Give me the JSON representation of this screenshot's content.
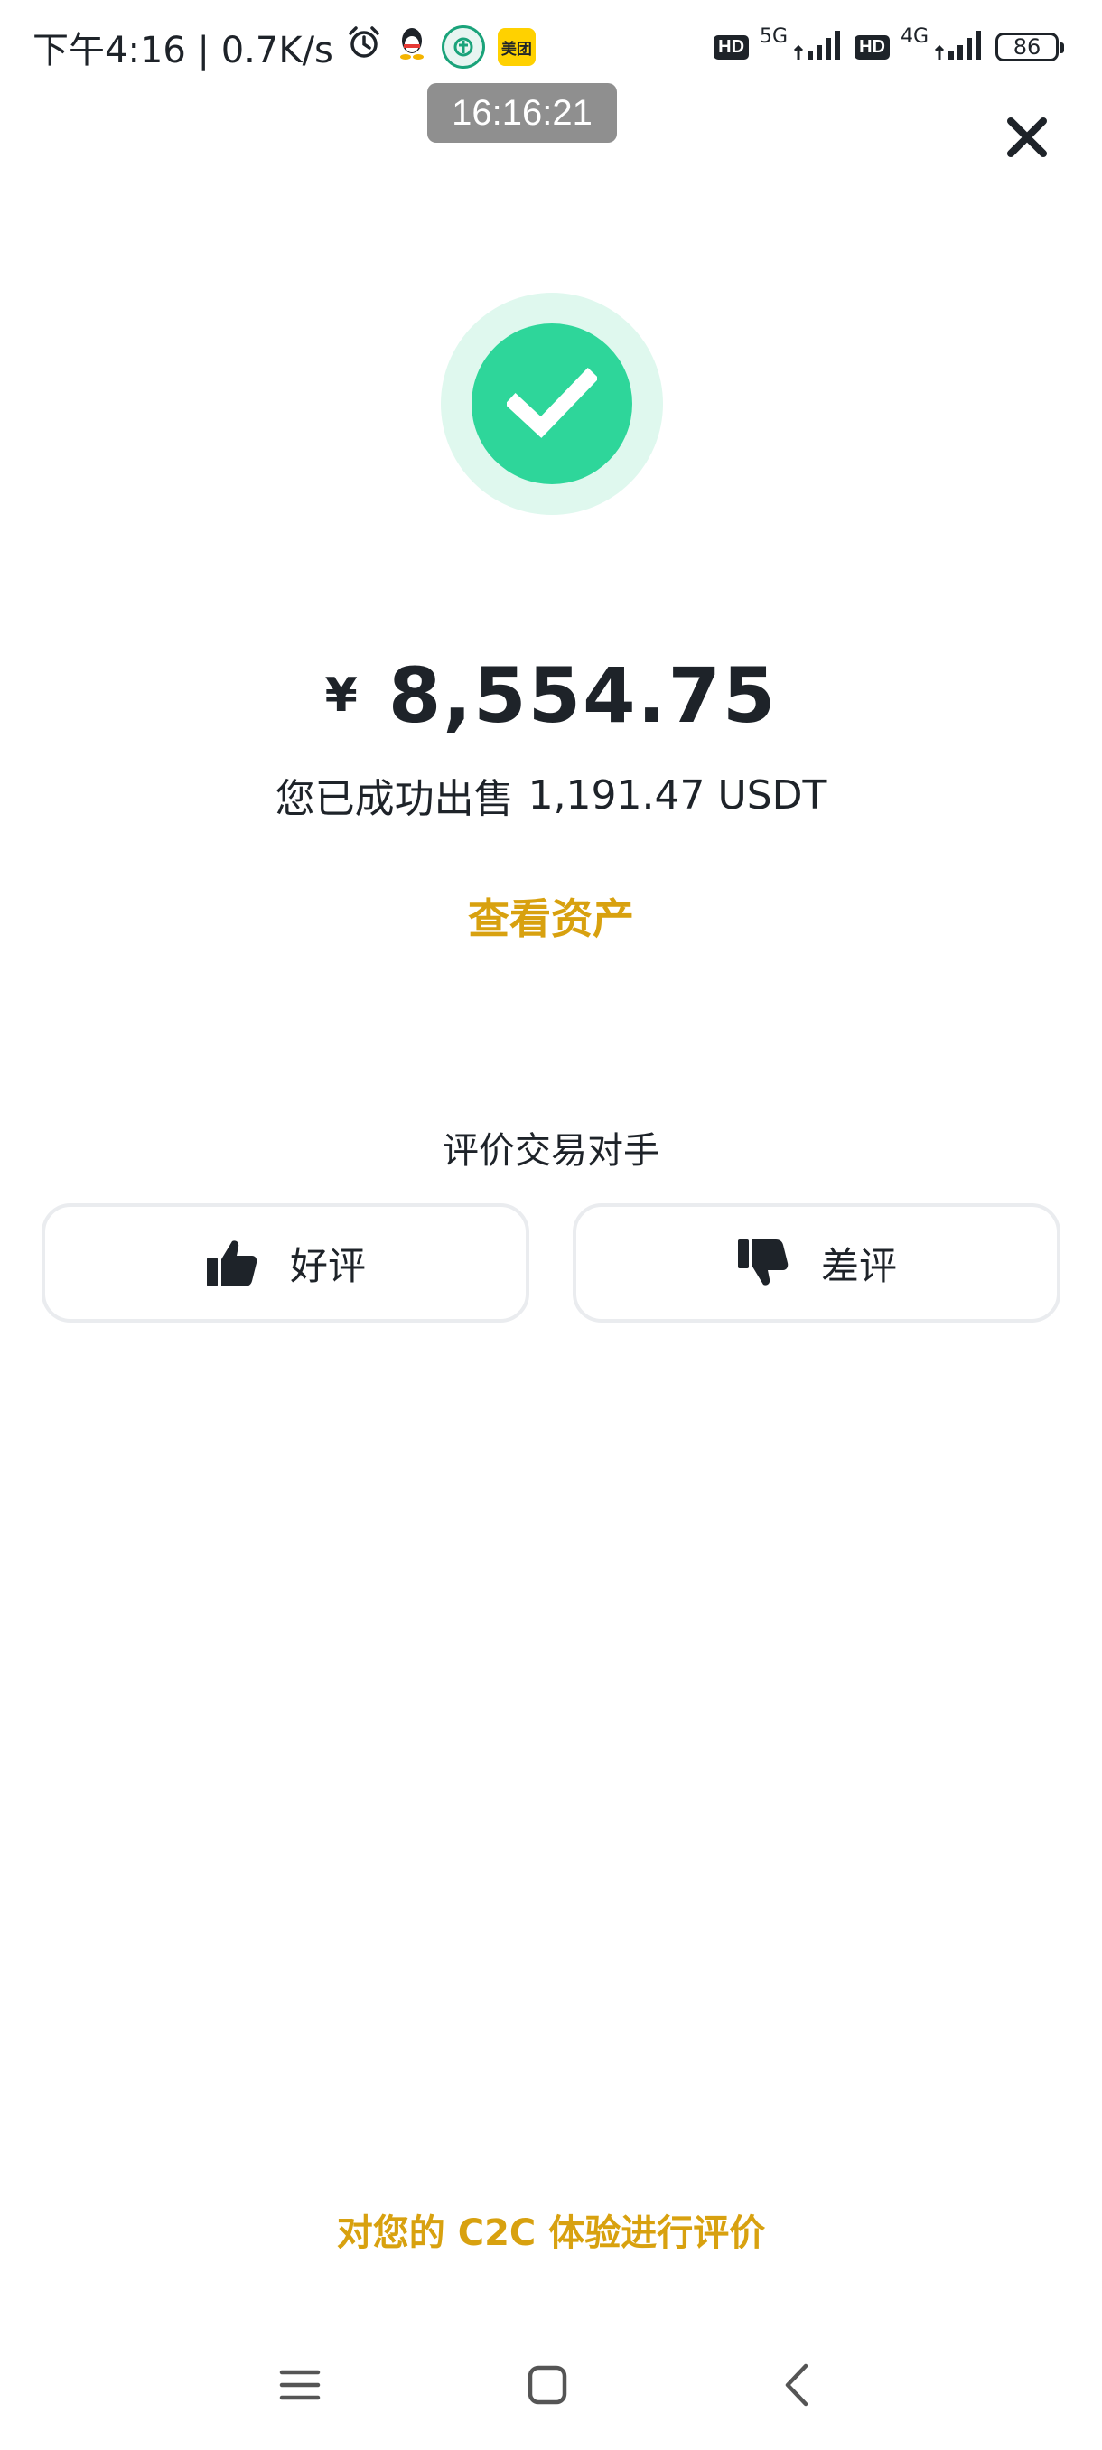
{
  "status_bar": {
    "time_and_speed": "下午4:16 | 0.7K/s",
    "meituan_label": "美团",
    "hd_label": "HD",
    "net_5g": "5G",
    "net_4g": "4G",
    "battery": "86"
  },
  "time_overlay": "16:16:21",
  "success": {
    "currency_symbol": "¥",
    "amount": "8,554.75",
    "sold_prefix": "您已成功出售",
    "sold_amount": "1,191.47 USDT",
    "view_assets": "查看资产"
  },
  "rating": {
    "title": "评价交易对手",
    "good_label": "好评",
    "bad_label": "差评"
  },
  "feedback_link": "对您的 C2C 体验进行评价",
  "colors": {
    "success_green": "#2ed69a",
    "success_halo": "#dff8ee",
    "accent_gold": "#d8a10f",
    "text_dark": "#1e2329",
    "border_gray": "#eaecef"
  }
}
